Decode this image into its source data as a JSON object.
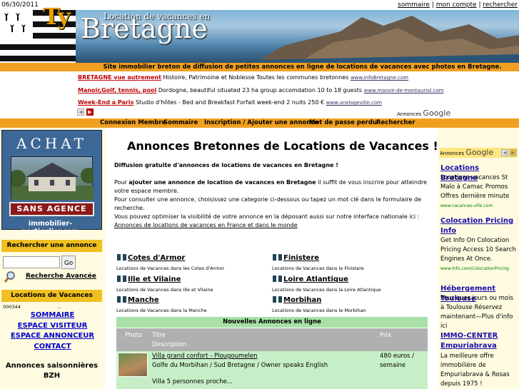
{
  "top": {
    "date": "06/30/2011",
    "links": [
      "sommaire",
      "mon compte",
      "rechercher"
    ],
    "separator": "|"
  },
  "header": {
    "ty": "Ty",
    "location": "Location  de vacances en",
    "bretagne": "Bretagne"
  },
  "slogan": "Site immobilier breton de diffusion de petites annonces en ligne de locations de vacances avec photos en Bretagne.",
  "top_ads": [
    {
      "title": "BRETAGNE vue autrement",
      "text": "Histoire, Patrimoine et Noblesse Toutes les communes bretonnes",
      "url": "www.infoBretagne.com"
    },
    {
      "title": "Manoir,Golf, tennis, pool",
      "text": "Dordogne, beautiful situated 23 ha group accomdation 10 to 18 guests",
      "url": "www.manoir-de-montauriol.com"
    },
    {
      "title": "Week-End a Paris",
      "text": "Studio d'hôtes - Bed and Breakfast Forfait week-end 2 nuits 250 €",
      "url": "www.unelogeville.com"
    }
  ],
  "ads_by": "Annonces",
  "google": "Google",
  "nav": [
    "Connexion Membre",
    "Sommaire",
    "Inscription / Ajouter une annonce",
    "Mot de passe perdu",
    "Rechercher"
  ],
  "left": {
    "achat": "ACHAT",
    "sans_agence": "SANS AGENCE",
    "immo": "immobilier-particulier.com",
    "search_title": "Rechercher une annonce",
    "search_value": "",
    "go": "Go",
    "advanced": "Recherche Avancée",
    "locations_title": "Locations de Vacances",
    "counter": "000344",
    "counter_dots": "...",
    "links": [
      "SOMMAIRE",
      "ESPACE VISITEUR",
      "ESPACE ANNONCEUR",
      "CONTACT"
    ],
    "saisonnieres": "Annonces saisonnières BZH"
  },
  "main": {
    "title": "Annonces Bretonnes de Locations de Vacances !",
    "intro": "Diffusion gratuite d'annonces de locations de vacances en Bretagne !",
    "p1_pre": "Pour ",
    "p1_bold": "ajouter une annonce de location de vacances en Bretagne",
    "p1_post": " il suffit de vous inscrire pour atteindre votre espace membre.",
    "p2": "Pour consulter une annonce, choisissez une categorie ci-dessous ou tapez un mot clé dans le formulaire de recherche.",
    "p3": "Vous pouvez optimiser la visibilité de votre annonce en la déposant aussi sur notre interface nationale ici :",
    "p3_link": "Annonces de locations de vacances en France et dans le monde",
    "regions": [
      {
        "name": "Cotes d'Armor",
        "sub": "Locations de Vacances dans les Cotes d'Armor"
      },
      {
        "name": "Finistere",
        "sub": "Locations de Vacances dans le Finistere"
      },
      {
        "name": "Ille et Vilaine",
        "sub": "Locations de Vacances dans Ille et Vilaine"
      },
      {
        "name": "Loire Atlantique",
        "sub": "Locations de Vacances dans la Loire Atlantique"
      },
      {
        "name": "Manche",
        "sub": "Locations de Vacances dans la Manche"
      },
      {
        "name": "Morbihan",
        "sub": "Locations de Vacances dans le Morbihan"
      }
    ],
    "nouvelles": "Nouvelles Annonces en ligne",
    "table_head": {
      "photo": "Photo",
      "titre": "Titre",
      "description": "Description",
      "prix": "Prix"
    },
    "row": {
      "title": "Villa grand confort - Plougoumelen",
      "desc": "Golfe du Morbihan / Sud Bretagne / Owner speaks English",
      "desc2": "Villa 5 personnes proche...",
      "price": "480 euros /",
      "price2": "semaine"
    }
  },
  "right_ads": [
    {
      "title": "Locations Bretagne",
      "text": "Locations vacances St Malo à Camac Promos Offres dernière minute",
      "url": "www.vacances-ville.com"
    },
    {
      "title": "Colocation Pricing Info",
      "text": "Get Info On Colocation Pricing Access 10 Search Engines At Once.",
      "url": "www.Info.com/ColocationPricing"
    },
    {
      "title": "Hébergement Toulouse",
      "text": "Pour ques jours ou mois à Toulouse Réservez maintenant—Plus d'info ici",
      "url": ""
    },
    {
      "title": "IMMO-CENTER Empuriabrava",
      "text": "La meilleure offre immobilière de Empuriabrava & Rosas depuis 1975 !",
      "url": ""
    }
  ]
}
